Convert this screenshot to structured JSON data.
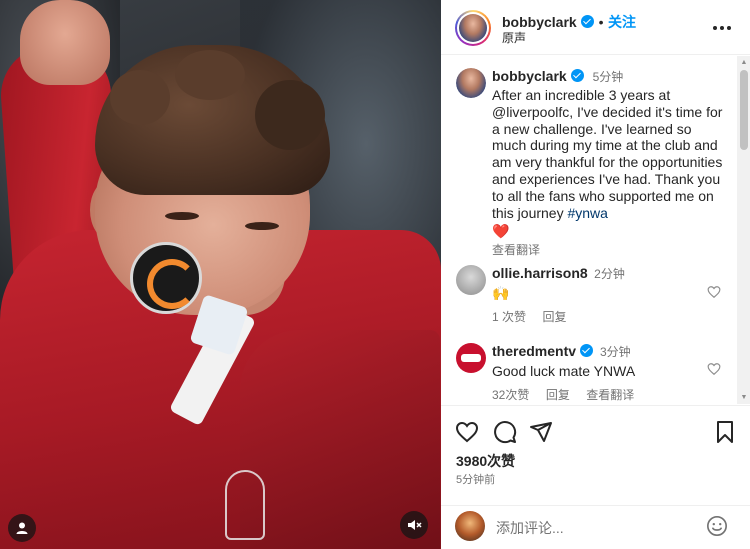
{
  "post": {
    "author": "bobbyclark",
    "follow_label": "关注",
    "audio_label": "原声",
    "caption_time": "5分钟",
    "caption_text": "After an incredible 3 years at @liverpoolfc, I've decided it's time for a new challenge. I've learned so much during my time at the club and am very thankful for the opportunities and experiences I've had. Thank you to all the fans who supported me on this journey",
    "caption_hashtag": "#ynwa",
    "caption_emoji": "❤️",
    "see_translation": "查看翻译",
    "more_icon": "more-horizontal-icon"
  },
  "comments": [
    {
      "username": "ollie.harrison8",
      "time": "2分钟",
      "text": "🙌",
      "likes": "1 次赞",
      "reply": "回复",
      "verified": false
    },
    {
      "username": "theredmentv",
      "time": "3分钟",
      "text": "Good luck mate YNWA",
      "likes": "32次赞",
      "reply": "回复",
      "translate": "查看翻译",
      "verified": true
    }
  ],
  "actions": {
    "like_count": "3980次赞",
    "posted_time": "5分钟前",
    "icons": [
      "heart-icon",
      "comment-icon",
      "share-icon",
      "bookmark-icon"
    ]
  },
  "comment_box": {
    "placeholder": "添加评论...",
    "emoji_icon": "smiley-icon"
  },
  "media": {
    "icons": [
      "profile-icon",
      "mute-icon"
    ],
    "jersey_red": "#c52430"
  },
  "colors": {
    "link_blue": "#0095f6",
    "hashtag": "#00376b",
    "heart_red": "#ed4956",
    "muted": "#737373"
  }
}
